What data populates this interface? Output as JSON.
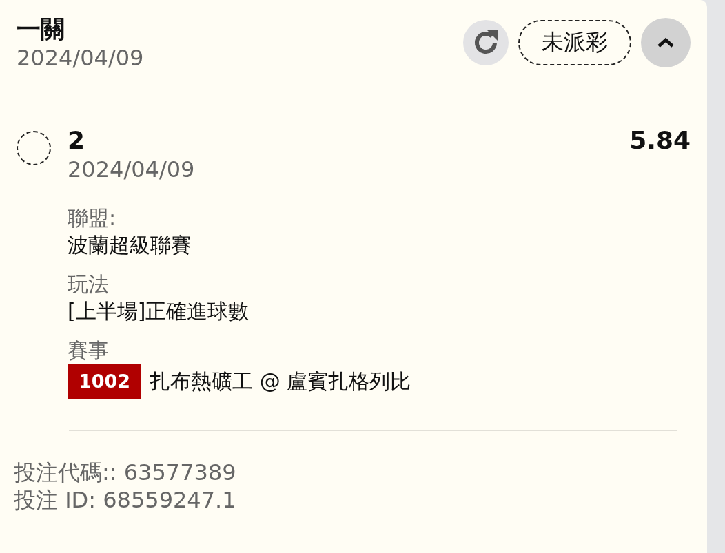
{
  "bet": {
    "title": "一關",
    "date": "2024/04/09",
    "status": "未派彩",
    "expanded": true
  },
  "legs": [
    {
      "selected": false,
      "selection": "2",
      "date": "2024/04/09",
      "odds": "5.84",
      "fields": [
        {
          "label": "聯盟:",
          "value": "波蘭超級聯賽"
        },
        {
          "label": "玩法",
          "value": "[上半場]正確進球數"
        },
        {
          "label": "賽事",
          "match_no": "1002",
          "value": "扎布熱礦工 @ 盧賓扎格列比"
        }
      ]
    }
  ],
  "footer": [
    "投注代碼:: 63577389",
    "投注 ID: 68559247.1"
  ]
}
